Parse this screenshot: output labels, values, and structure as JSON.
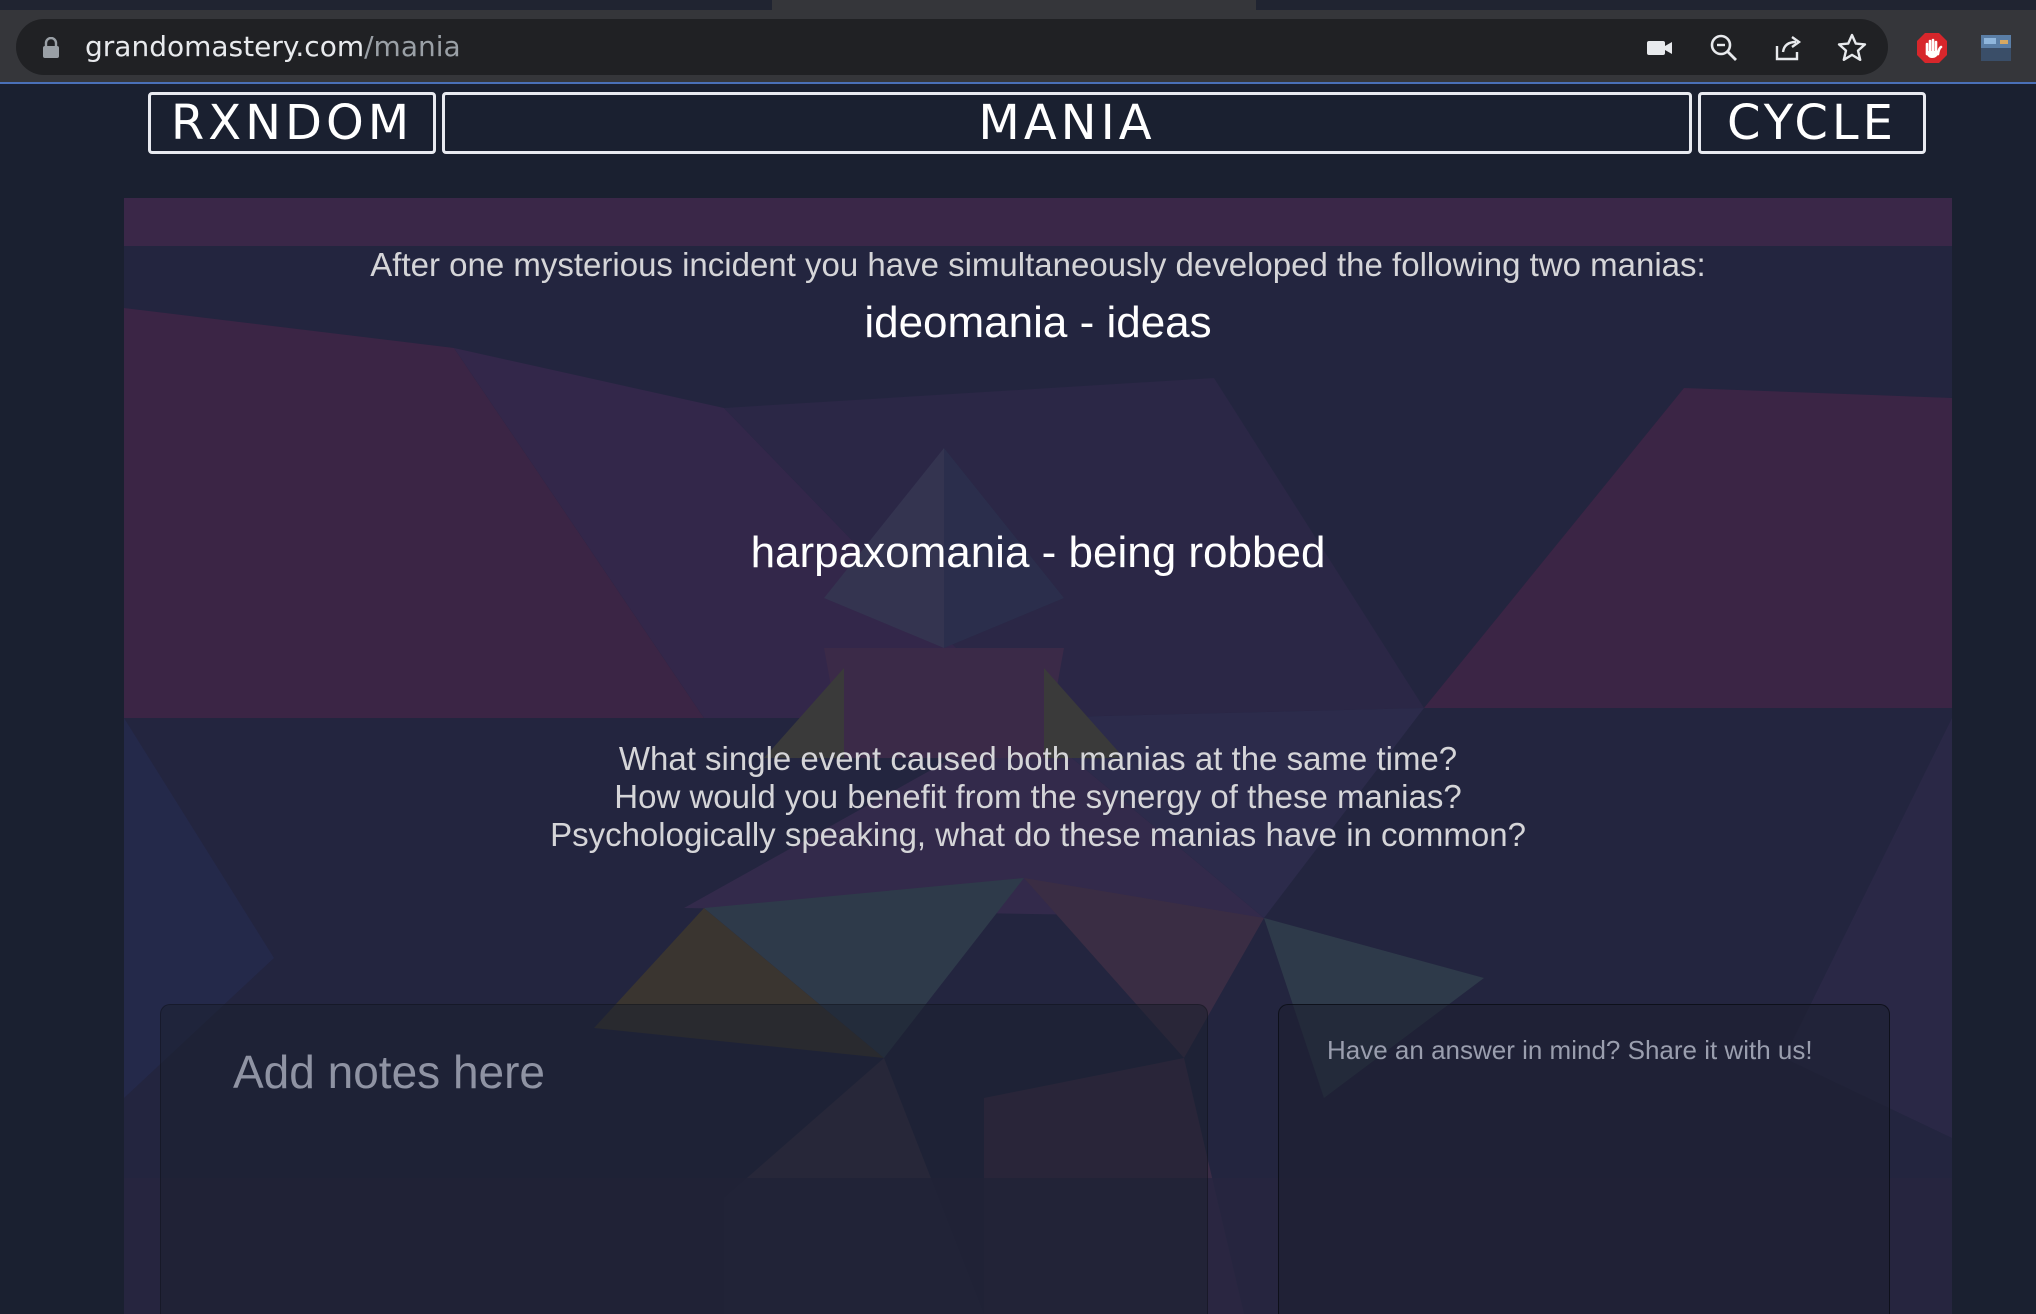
{
  "browser": {
    "url_host": "grandomastery.com",
    "url_path": "/mania",
    "icons": [
      "lock-icon",
      "camera-icon",
      "zoom-icon",
      "share-icon",
      "star-icon",
      "extension-hand-icon",
      "profile-icon"
    ]
  },
  "header": {
    "random_label": "RXNDOM",
    "title": "MANIA",
    "cycle_label": "CYCLE"
  },
  "content": {
    "intro": "After one mysterious incident you have simultaneously developed the following two manias:",
    "mania_1": "ideomania - ideas",
    "mania_2": "harpaxomania - being robbed",
    "questions": [
      "What single event caused both manias at the same time?",
      "How would you benefit from the synergy of these manias?",
      "Psychologically speaking, what do these manias have in common?"
    ]
  },
  "inputs": {
    "notes_placeholder": "Add notes here",
    "answer_placeholder": "Have an answer in mind? Share it with us!"
  },
  "colors": {
    "page_bg": "#1a2030",
    "accent_red": "#d7262b",
    "header_border": "#e8eaf0"
  }
}
